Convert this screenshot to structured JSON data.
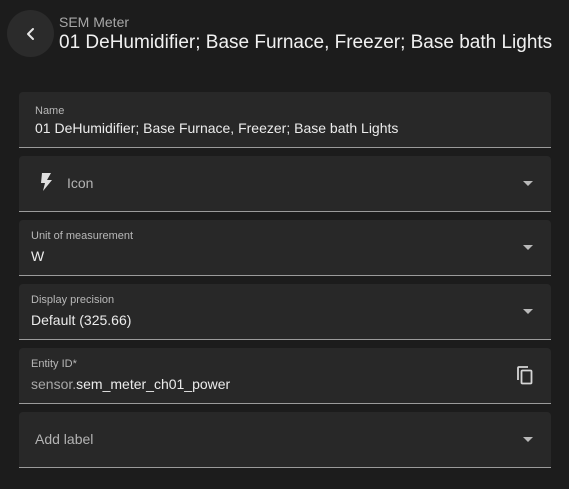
{
  "header": {
    "subtitle": "SEM Meter",
    "title": "01 DeHumidifier; Base Furnace, Freezer; Base bath Lights"
  },
  "fields": {
    "name": {
      "label": "Name",
      "value": "01  DeHumidifier; Base Furnace, Freezer; Base bath Lights"
    },
    "icon": {
      "icon": "lightning-bolt-icon",
      "placeholder": "Icon"
    },
    "unit": {
      "label": "Unit of measurement",
      "value": "W"
    },
    "precision": {
      "label": "Display precision",
      "value": "Default (325.66)"
    },
    "entity_id": {
      "label": "Entity ID*",
      "prefix": "sensor.",
      "value": "sem_meter_ch01_power"
    },
    "add_label": {
      "placeholder": "Add label"
    }
  },
  "colors": {
    "background": "#1c1c1c",
    "field_background": "#282828",
    "underline": "#9b9b9b"
  }
}
